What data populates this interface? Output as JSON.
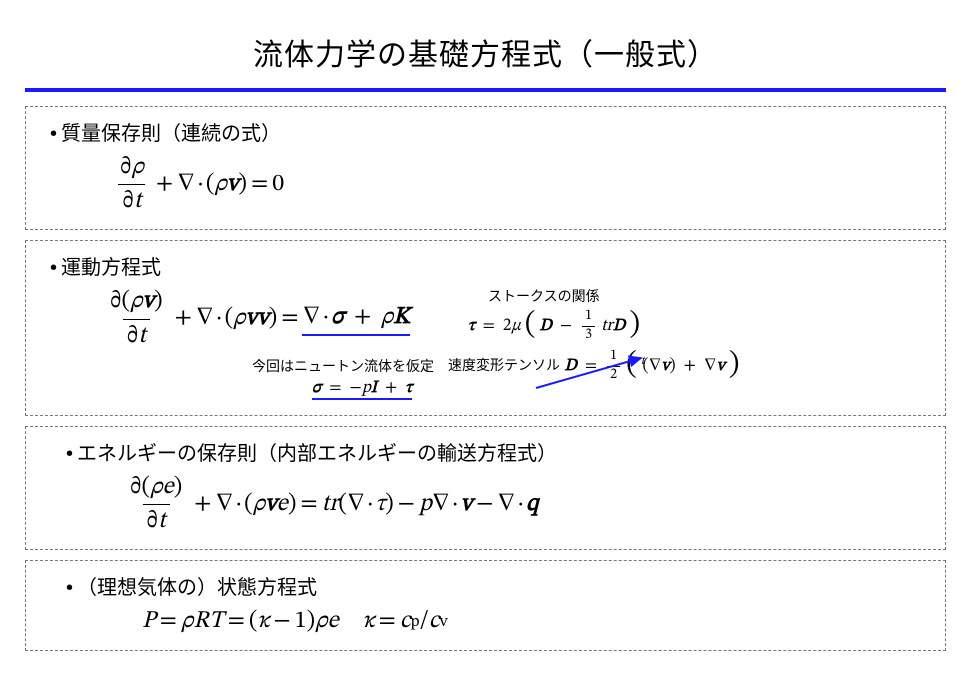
{
  "title": "流体力学の基礎方程式（一般式）",
  "blocks": {
    "mass": {
      "heading": "質量保存則（連続の式）",
      "equation_text": "∂ρ/∂t + ∇·(ρv) = 0"
    },
    "momentum": {
      "heading": "運動方程式",
      "equation_text": "∂(ρv)/∂t + ∇·(ρvv) = ∇·σ + ρK",
      "newton_note": "今回はニュートン流体を仮定",
      "sigma_def_text": "σ = −pI + τ",
      "stokes_label": "ストークスの関係",
      "stokes_relation_text": "τ = 2μ ( D − (1/3) tr D )",
      "def_tensor_label": "速度変形テンソル",
      "def_tensor_text": "D = 1/2 ( ᵗ(∇v) + ∇v )"
    },
    "energy": {
      "heading": "エネルギーの保存則（内部エネルギーの輸送方程式）",
      "equation_text": "∂(ρe)/∂t + ∇·(ρve) = tr(∇·τ) − p∇·v − ∇·q"
    },
    "state": {
      "heading": "（理想気体の）状態方程式",
      "equation_text": "P = ρRT = (κ − 1)ρe  ,  κ = c_p / c_v"
    }
  },
  "symbols": {
    "partial": "∂",
    "nabla": "∇",
    "dot": "·",
    "rho": "ρ",
    "sigma": "σ",
    "tau": "τ",
    "mu": "μ",
    "kappa": "κ",
    "minus": "−",
    "plus": "+",
    "equals": "=",
    "lparen": "(",
    "rparen": ")",
    "t": "t",
    "v": "v",
    "I": "I",
    "K": "K",
    "D": "D",
    "p": "p",
    "P": "P",
    "R": "R",
    "T": "T",
    "e": "e",
    "q": "q",
    "tr": "tr",
    "zero": "0",
    "one": "1",
    "two": "2",
    "three": "3",
    "cp": "c",
    "cp_sub": "p",
    "cv": "c",
    "cv_sub": "v",
    "slash": "/",
    "lbig": "(",
    "rbig": ")",
    "pretranspose": "t"
  }
}
